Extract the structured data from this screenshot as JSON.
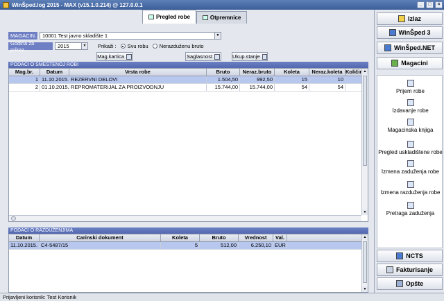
{
  "window": {
    "title": "WinŠped.log 2015 - MAX (v15.1.0.214) @ 127.0.0.1"
  },
  "tabs": [
    {
      "label": "Pregled robe"
    },
    {
      "label": "Otpremnice"
    }
  ],
  "filters": {
    "magacin_label": "MAGACIN...",
    "magacin_value": "10001 Test javno skladište 1",
    "godina_label": "Godina za prikaz...",
    "godina_value": "2015",
    "prikazi_label": "Prikaži :",
    "radio_all": "Svu robu",
    "radio_unbooked": "Nerazduženu bruto"
  },
  "toolbar": {
    "mag_kartica": "Mag.kartica",
    "saglasnost": "Saglasnost",
    "ukup_stanje": "Ukup.stanje"
  },
  "stored": {
    "section_title": "PODACI O SMEŠTENOJ ROBI",
    "columns": [
      "Mag.br.",
      "Datum",
      "Vrsta robe",
      "Bruto",
      "Neraz.bruto",
      "Koleta",
      "Neraz.koleta",
      "Količina"
    ],
    "rows": [
      {
        "mag": "1",
        "datum": "11.10.2015.",
        "vrsta": "REZERVNI DELOVI",
        "bruto": "1.504,50",
        "neraz_bruto": "992,50",
        "koleta": "15",
        "neraz_koleta": "10",
        "kolicina": ""
      },
      {
        "mag": "2",
        "datum": "01.10.2015.",
        "vrsta": "REPROMATERIJAL ZA PROIZVODNJU",
        "bruto": "15.744,00",
        "neraz_bruto": "15.744,00",
        "koleta": "54",
        "neraz_koleta": "54",
        "kolicina": ""
      }
    ]
  },
  "discharge": {
    "section_title": "PODACI O RAZDUŽENJIMA",
    "columns": [
      "Datum",
      "Carinski dokument",
      "Koleta",
      "Bruto",
      "Vrednost",
      "Val."
    ],
    "rows": [
      {
        "datum": "11.10.2015.",
        "dokument": "C4-5487/15",
        "koleta": "5",
        "bruto": "512,00",
        "vrednost": "6.250,10",
        "val": "EUR"
      }
    ]
  },
  "sidebar": {
    "top_buttons": [
      {
        "label": "Izlaz"
      },
      {
        "label": "WinŠped 3"
      },
      {
        "label": "WinŠped.NET"
      },
      {
        "label": "Magacini"
      }
    ],
    "items": [
      {
        "label": "Prijem robe"
      },
      {
        "label": "Izdavanje robe"
      },
      {
        "label": "Magacinska knjiga"
      },
      {
        "label": "Pregled uskladištene robe"
      },
      {
        "label": "Izmena zaduženja robe"
      },
      {
        "label": "Izmena razduženja robe"
      },
      {
        "label": "Pretraga zaduženja"
      }
    ],
    "bottom_buttons": [
      {
        "label": "NCTS"
      },
      {
        "label": "Fakturisanje"
      },
      {
        "label": "Opšte"
      }
    ]
  },
  "status": {
    "text": "Prijavljeni korisnik: Test Korisnik"
  }
}
